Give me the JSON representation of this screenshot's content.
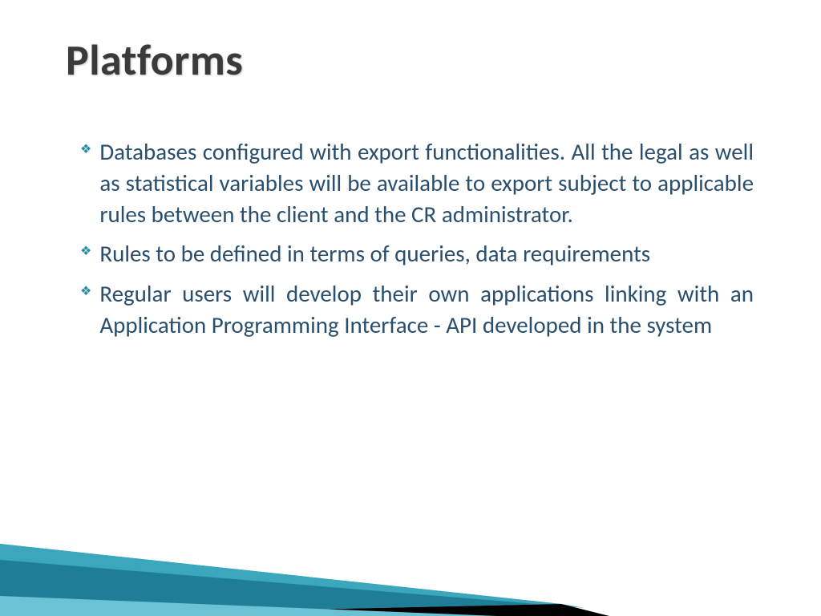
{
  "slide": {
    "title": "Platforms",
    "bullets": [
      "Databases configured with export functionalities. All the legal as well as statistical variables will be available to export subject to applicable rules between the client and the CR administrator.",
      "Rules to be defined in terms of queries, data requirements",
      "Regular users will develop their own applications linking with an Application Programming Interface - API developed in the system"
    ]
  }
}
